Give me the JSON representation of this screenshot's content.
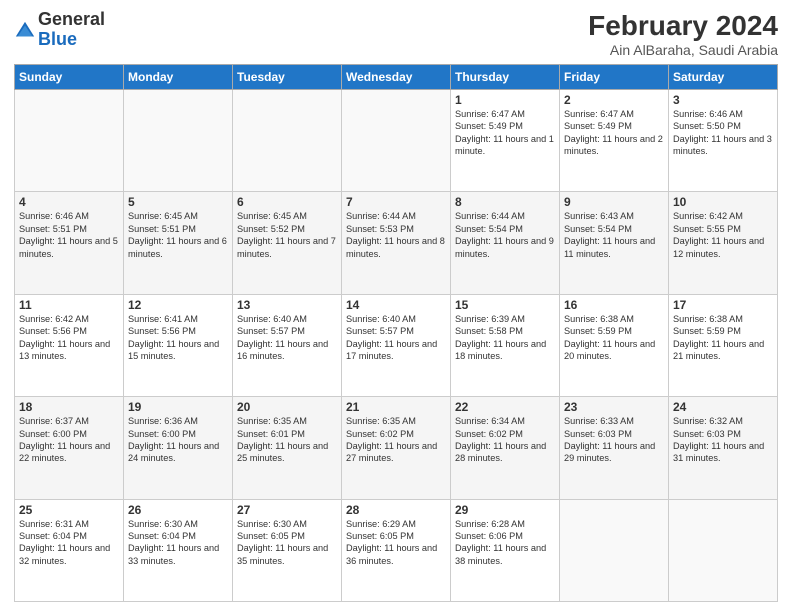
{
  "logo": {
    "general": "General",
    "blue": "Blue"
  },
  "header": {
    "month": "February 2024",
    "location": "Ain AlBaraha, Saudi Arabia"
  },
  "weekdays": [
    "Sunday",
    "Monday",
    "Tuesday",
    "Wednesday",
    "Thursday",
    "Friday",
    "Saturday"
  ],
  "weeks": [
    [
      {
        "day": "",
        "info": ""
      },
      {
        "day": "",
        "info": ""
      },
      {
        "day": "",
        "info": ""
      },
      {
        "day": "",
        "info": ""
      },
      {
        "day": "1",
        "info": "Sunrise: 6:47 AM\nSunset: 5:49 PM\nDaylight: 11 hours and 1 minute."
      },
      {
        "day": "2",
        "info": "Sunrise: 6:47 AM\nSunset: 5:49 PM\nDaylight: 11 hours and 2 minutes."
      },
      {
        "day": "3",
        "info": "Sunrise: 6:46 AM\nSunset: 5:50 PM\nDaylight: 11 hours and 3 minutes."
      }
    ],
    [
      {
        "day": "4",
        "info": "Sunrise: 6:46 AM\nSunset: 5:51 PM\nDaylight: 11 hours and 5 minutes."
      },
      {
        "day": "5",
        "info": "Sunrise: 6:45 AM\nSunset: 5:51 PM\nDaylight: 11 hours and 6 minutes."
      },
      {
        "day": "6",
        "info": "Sunrise: 6:45 AM\nSunset: 5:52 PM\nDaylight: 11 hours and 7 minutes."
      },
      {
        "day": "7",
        "info": "Sunrise: 6:44 AM\nSunset: 5:53 PM\nDaylight: 11 hours and 8 minutes."
      },
      {
        "day": "8",
        "info": "Sunrise: 6:44 AM\nSunset: 5:54 PM\nDaylight: 11 hours and 9 minutes."
      },
      {
        "day": "9",
        "info": "Sunrise: 6:43 AM\nSunset: 5:54 PM\nDaylight: 11 hours and 11 minutes."
      },
      {
        "day": "10",
        "info": "Sunrise: 6:42 AM\nSunset: 5:55 PM\nDaylight: 11 hours and 12 minutes."
      }
    ],
    [
      {
        "day": "11",
        "info": "Sunrise: 6:42 AM\nSunset: 5:56 PM\nDaylight: 11 hours and 13 minutes."
      },
      {
        "day": "12",
        "info": "Sunrise: 6:41 AM\nSunset: 5:56 PM\nDaylight: 11 hours and 15 minutes."
      },
      {
        "day": "13",
        "info": "Sunrise: 6:40 AM\nSunset: 5:57 PM\nDaylight: 11 hours and 16 minutes."
      },
      {
        "day": "14",
        "info": "Sunrise: 6:40 AM\nSunset: 5:57 PM\nDaylight: 11 hours and 17 minutes."
      },
      {
        "day": "15",
        "info": "Sunrise: 6:39 AM\nSunset: 5:58 PM\nDaylight: 11 hours and 18 minutes."
      },
      {
        "day": "16",
        "info": "Sunrise: 6:38 AM\nSunset: 5:59 PM\nDaylight: 11 hours and 20 minutes."
      },
      {
        "day": "17",
        "info": "Sunrise: 6:38 AM\nSunset: 5:59 PM\nDaylight: 11 hours and 21 minutes."
      }
    ],
    [
      {
        "day": "18",
        "info": "Sunrise: 6:37 AM\nSunset: 6:00 PM\nDaylight: 11 hours and 22 minutes."
      },
      {
        "day": "19",
        "info": "Sunrise: 6:36 AM\nSunset: 6:00 PM\nDaylight: 11 hours and 24 minutes."
      },
      {
        "day": "20",
        "info": "Sunrise: 6:35 AM\nSunset: 6:01 PM\nDaylight: 11 hours and 25 minutes."
      },
      {
        "day": "21",
        "info": "Sunrise: 6:35 AM\nSunset: 6:02 PM\nDaylight: 11 hours and 27 minutes."
      },
      {
        "day": "22",
        "info": "Sunrise: 6:34 AM\nSunset: 6:02 PM\nDaylight: 11 hours and 28 minutes."
      },
      {
        "day": "23",
        "info": "Sunrise: 6:33 AM\nSunset: 6:03 PM\nDaylight: 11 hours and 29 minutes."
      },
      {
        "day": "24",
        "info": "Sunrise: 6:32 AM\nSunset: 6:03 PM\nDaylight: 11 hours and 31 minutes."
      }
    ],
    [
      {
        "day": "25",
        "info": "Sunrise: 6:31 AM\nSunset: 6:04 PM\nDaylight: 11 hours and 32 minutes."
      },
      {
        "day": "26",
        "info": "Sunrise: 6:30 AM\nSunset: 6:04 PM\nDaylight: 11 hours and 33 minutes."
      },
      {
        "day": "27",
        "info": "Sunrise: 6:30 AM\nSunset: 6:05 PM\nDaylight: 11 hours and 35 minutes."
      },
      {
        "day": "28",
        "info": "Sunrise: 6:29 AM\nSunset: 6:05 PM\nDaylight: 11 hours and 36 minutes."
      },
      {
        "day": "29",
        "info": "Sunrise: 6:28 AM\nSunset: 6:06 PM\nDaylight: 11 hours and 38 minutes."
      },
      {
        "day": "",
        "info": ""
      },
      {
        "day": "",
        "info": ""
      }
    ]
  ]
}
